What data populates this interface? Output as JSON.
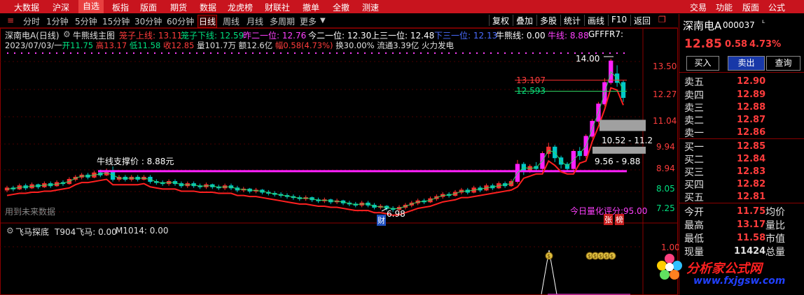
{
  "menu": {
    "items": [
      "大数据",
      "沪深",
      "自选",
      "板指",
      "版面",
      "期货",
      "数据",
      "龙虎榜",
      "财联社",
      "撤单",
      "全撤",
      "测速"
    ],
    "right_items": [
      "交易",
      "功能",
      "版面",
      "公式"
    ]
  },
  "toolbar": {
    "timeframes": [
      "分时",
      "1分钟",
      "5分钟",
      "15分钟",
      "30分钟",
      "60分钟",
      "日线",
      "周线",
      "月线",
      "多周期",
      "更多"
    ],
    "active_timeframe": "日线",
    "buttons": [
      "复权",
      "叠加",
      "多股",
      "统计",
      "画线",
      "F10",
      "返回"
    ]
  },
  "indicator_line": {
    "stock_label": "深南电A(日线)",
    "formula_name": "牛熊线主图",
    "items": [
      {
        "label": "笼子上线: 13.11",
        "color": "#ff3c3c"
      },
      {
        "label": "笼子下线: 12.59",
        "color": "#00e080"
      },
      {
        "label": "昨二一位: 12.76",
        "color": "#ff40ff"
      },
      {
        "label": "今二一位: 12.30",
        "color": "#ffffff"
      },
      {
        "label": "上三一位: 12.48",
        "color": "#ffffff"
      },
      {
        "label": "下三一位: 12.13",
        "color": "#4a6cff"
      },
      {
        "label": "牛熊线: 0.00",
        "color": "#ffffff"
      },
      {
        "label": "牛线: 8.88",
        "color": "#ff40ff"
      },
      {
        "label": "GFFFR7:",
        "color": "#ffffff"
      }
    ]
  },
  "quote_line": {
    "date": "2023/07/03/一",
    "open_label": "开",
    "open": "11.75",
    "high_label": "高",
    "high": "13.17",
    "low_label": "低",
    "low": "11.58",
    "close_label": "收",
    "close": "12.85",
    "vol_label": "量",
    "vol": "101.7万",
    "amt_label": "额",
    "amt": "12.6亿",
    "chg_label": "幅",
    "chg": "0.58(4.73%)",
    "turnover": "换30.00%",
    "float": "流通3.39亿",
    "sector": "火力发电"
  },
  "chart_annotations": {
    "support_label": "牛线支撑价 : 8.88元",
    "future_data": "用到未来数据",
    "high_mark": "14.00",
    "low_mark": "6.98",
    "cai_mark": "财",
    "score": "今日量化评分:95.00",
    "zhang_mark": "张",
    "bang_mark": "榜",
    "cage_upper": "13.107",
    "cage_lower": "12.593",
    "zone_upper": "10.52 - 11.2",
    "zone_lower": "9.56 - 9.88",
    "y_ticks": [
      "13.50",
      "12.27",
      "11.04",
      "9.94",
      "8.94",
      "8.05",
      "7.25"
    ]
  },
  "sub_indicator": {
    "title": "飞马探底",
    "t904": "T904飞马: 0.00",
    "m1014": "M1014: 0.00",
    "y_tick": "1.00",
    "coin_label": "$"
  },
  "chart_data": {
    "type": "candlestick",
    "ylim": [
      6.6,
      14.3
    ],
    "support_value": 8.88,
    "candles": [
      [
        8.0,
        8.1,
        8.2,
        7.9
      ],
      [
        8.1,
        8.05,
        8.2,
        7.95
      ],
      [
        8.05,
        8.2,
        8.3,
        8.0
      ],
      [
        8.2,
        8.1,
        8.3,
        8.0
      ],
      [
        8.1,
        8.25,
        8.35,
        8.05
      ],
      [
        8.25,
        8.15,
        8.3,
        8.05
      ],
      [
        8.15,
        8.3,
        8.4,
        8.1
      ],
      [
        8.3,
        8.2,
        8.4,
        8.1
      ],
      [
        8.2,
        8.35,
        8.45,
        8.15
      ],
      [
        8.35,
        8.3,
        8.45,
        8.2
      ],
      [
        8.3,
        8.5,
        8.6,
        8.25
      ],
      [
        8.5,
        8.6,
        8.7,
        8.4
      ],
      [
        8.6,
        8.7,
        8.8,
        8.5
      ],
      [
        8.7,
        8.6,
        8.8,
        8.5
      ],
      [
        8.6,
        8.8,
        8.9,
        8.55
      ],
      [
        8.8,
        8.7,
        8.95,
        8.6
      ],
      [
        8.7,
        8.9,
        9.0,
        8.65
      ],
      [
        8.9,
        8.5,
        9.1,
        8.4
      ],
      [
        8.5,
        8.6,
        8.7,
        8.4
      ],
      [
        8.6,
        8.5,
        8.7,
        8.4
      ],
      [
        8.5,
        8.6,
        8.7,
        8.4
      ],
      [
        8.6,
        8.5,
        8.7,
        8.4
      ],
      [
        8.5,
        8.6,
        8.7,
        8.45
      ],
      [
        8.6,
        8.4,
        8.7,
        8.3
      ],
      [
        8.4,
        8.35,
        8.5,
        8.25
      ],
      [
        8.35,
        8.3,
        8.45,
        8.2
      ],
      [
        8.3,
        8.4,
        8.5,
        8.2
      ],
      [
        8.4,
        8.3,
        8.5,
        8.2
      ],
      [
        8.3,
        8.2,
        8.4,
        8.1
      ],
      [
        8.2,
        8.3,
        8.4,
        8.1
      ],
      [
        8.3,
        8.2,
        8.4,
        8.1
      ],
      [
        8.2,
        8.15,
        8.3,
        8.05
      ],
      [
        8.15,
        8.25,
        8.35,
        8.05
      ],
      [
        8.25,
        8.15,
        8.3,
        8.05
      ],
      [
        8.15,
        8.1,
        8.25,
        8.0
      ],
      [
        8.1,
        8.2,
        8.3,
        8.0
      ],
      [
        8.2,
        8.1,
        8.3,
        8.0
      ],
      [
        8.1,
        8.0,
        8.2,
        7.9
      ],
      [
        8.0,
        8.05,
        8.15,
        7.9
      ],
      [
        8.05,
        7.95,
        8.1,
        7.85
      ],
      [
        7.95,
        8.0,
        8.1,
        7.85
      ],
      [
        8.0,
        7.9,
        8.05,
        7.8
      ],
      [
        7.9,
        7.85,
        8.0,
        7.75
      ],
      [
        7.85,
        7.8,
        7.95,
        7.7
      ],
      [
        7.8,
        7.75,
        7.9,
        7.65
      ],
      [
        7.75,
        7.7,
        7.85,
        7.6
      ],
      [
        7.7,
        7.65,
        7.8,
        7.55
      ],
      [
        7.65,
        7.6,
        7.75,
        7.5
      ],
      [
        7.6,
        7.65,
        7.75,
        7.5
      ],
      [
        7.65,
        7.55,
        7.7,
        7.45
      ],
      [
        7.55,
        7.5,
        7.65,
        7.4
      ],
      [
        7.5,
        7.55,
        7.65,
        7.4
      ],
      [
        7.55,
        7.45,
        7.6,
        7.35
      ],
      [
        7.45,
        7.5,
        7.6,
        7.35
      ],
      [
        7.5,
        7.4,
        7.55,
        7.3
      ],
      [
        7.4,
        7.35,
        7.5,
        7.25
      ],
      [
        7.35,
        7.3,
        7.45,
        7.2
      ],
      [
        7.3,
        7.4,
        7.5,
        7.2
      ],
      [
        7.4,
        7.3,
        7.5,
        7.2
      ],
      [
        7.3,
        7.2,
        7.4,
        7.1
      ],
      [
        7.2,
        7.25,
        7.35,
        7.1
      ],
      [
        7.25,
        7.15,
        7.3,
        7.05
      ],
      [
        7.15,
        7.1,
        7.25,
        6.98
      ],
      [
        7.1,
        7.2,
        7.3,
        7.0
      ],
      [
        7.2,
        7.3,
        7.4,
        7.1
      ],
      [
        7.3,
        7.4,
        7.5,
        7.2
      ],
      [
        7.4,
        7.5,
        7.6,
        7.3
      ],
      [
        7.5,
        7.45,
        7.6,
        7.35
      ],
      [
        7.45,
        7.6,
        7.7,
        7.4
      ],
      [
        7.6,
        7.7,
        7.8,
        7.5
      ],
      [
        7.7,
        7.8,
        7.9,
        7.6
      ],
      [
        7.8,
        7.75,
        7.9,
        7.65
      ],
      [
        7.75,
        7.9,
        8.0,
        7.7
      ],
      [
        7.9,
        8.0,
        8.1,
        7.8
      ],
      [
        8.0,
        7.9,
        8.1,
        7.8
      ],
      [
        7.9,
        8.1,
        8.2,
        7.85
      ],
      [
        8.1,
        8.0,
        8.2,
        7.9
      ],
      [
        8.0,
        8.2,
        8.3,
        7.95
      ],
      [
        8.2,
        8.1,
        8.3,
        8.0
      ],
      [
        8.1,
        8.3,
        8.4,
        8.05
      ],
      [
        8.3,
        8.2,
        8.4,
        8.1
      ],
      [
        8.2,
        8.4,
        8.5,
        8.15
      ],
      [
        8.4,
        9.2,
        9.4,
        8.3
      ],
      [
        9.2,
        8.9,
        9.3,
        8.7
      ],
      [
        8.9,
        9.1,
        9.2,
        8.8
      ],
      [
        9.1,
        9.0,
        9.3,
        8.9
      ],
      [
        9.0,
        9.7,
        9.8,
        8.9
      ],
      [
        9.7,
        10.0,
        10.2,
        9.5
      ],
      [
        10.0,
        9.5,
        10.1,
        9.3
      ],
      [
        9.5,
        9.2,
        9.6,
        9.0
      ],
      [
        9.2,
        9.0,
        9.3,
        8.9
      ],
      [
        9.0,
        9.8,
        9.9,
        8.9
      ],
      [
        9.8,
        9.6,
        10.0,
        9.4
      ],
      [
        9.6,
        10.5,
        10.6,
        9.5
      ],
      [
        10.5,
        11.2,
        11.3,
        10.4
      ],
      [
        11.2,
        12.0,
        12.1,
        11.1
      ],
      [
        12.0,
        13.0,
        13.2,
        11.9
      ],
      [
        13.0,
        14.0,
        14.1,
        12.9
      ],
      [
        13.4,
        13.0,
        13.8,
        12.8
      ],
      [
        13.0,
        12.3,
        13.1,
        12.1
      ]
    ]
  },
  "right_panel": {
    "stock_name": "深南电A",
    "code": "000037",
    "price": "12.85",
    "change": "0.58",
    "pct": "4.73%",
    "buy_btn": "买入",
    "sell_btn": "卖出",
    "query_btn": "查询",
    "asks": [
      {
        "label": "卖五",
        "price": "12.90"
      },
      {
        "label": "卖四",
        "price": "12.89"
      },
      {
        "label": "卖三",
        "price": "12.88"
      },
      {
        "label": "卖二",
        "price": "12.87"
      },
      {
        "label": "卖一",
        "price": "12.86"
      }
    ],
    "bids": [
      {
        "label": "买一",
        "price": "12.85"
      },
      {
        "label": "买二",
        "price": "12.84"
      },
      {
        "label": "买三",
        "price": "12.83"
      },
      {
        "label": "买四",
        "price": "12.82"
      },
      {
        "label": "买五",
        "price": "12.81"
      }
    ],
    "stats": [
      {
        "label": "今开",
        "value": "11.75",
        "label2": "均价"
      },
      {
        "label": "最高",
        "value": "13.17",
        "label2": "量比"
      },
      {
        "label": "最低",
        "value": "11.58",
        "label2": "市值"
      },
      {
        "label": "现量",
        "value": "11424",
        "label2": "总量"
      }
    ]
  },
  "watermark": {
    "title": "分析家公式网",
    "url": "www.fxjgsw.com"
  }
}
